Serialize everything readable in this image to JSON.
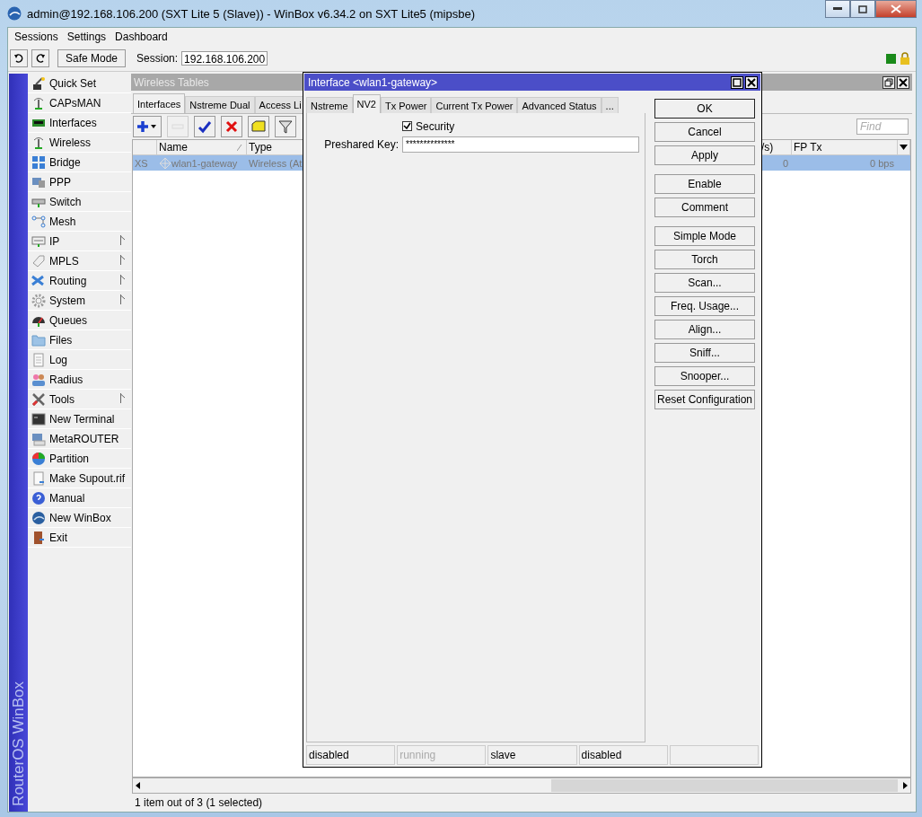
{
  "window": {
    "title": "admin@192.168.106.200 (SXT Lite 5 (Slave)) - WinBox v6.34.2 on SXT Lite5 (mipsbe)"
  },
  "menu": [
    "Sessions",
    "Settings",
    "Dashboard"
  ],
  "toolbar": {
    "safe_mode": "Safe Mode",
    "session_label": "Session:",
    "session": "192.168.106.200"
  },
  "sidebar": {
    "brand": "RouterOS WinBox",
    "items": [
      {
        "label": "Quick Set",
        "submenu": false
      },
      {
        "label": "CAPsMAN",
        "submenu": false
      },
      {
        "label": "Interfaces",
        "submenu": false
      },
      {
        "label": "Wireless",
        "submenu": false
      },
      {
        "label": "Bridge",
        "submenu": false
      },
      {
        "label": "PPP",
        "submenu": false
      },
      {
        "label": "Switch",
        "submenu": false
      },
      {
        "label": "Mesh",
        "submenu": false
      },
      {
        "label": "IP",
        "submenu": true
      },
      {
        "label": "MPLS",
        "submenu": true
      },
      {
        "label": "Routing",
        "submenu": true
      },
      {
        "label": "System",
        "submenu": true
      },
      {
        "label": "Queues",
        "submenu": false
      },
      {
        "label": "Files",
        "submenu": false
      },
      {
        "label": "Log",
        "submenu": false
      },
      {
        "label": "Radius",
        "submenu": false
      },
      {
        "label": "Tools",
        "submenu": true
      },
      {
        "label": "New Terminal",
        "submenu": false
      },
      {
        "label": "MetaROUTER",
        "submenu": false
      },
      {
        "label": "Partition",
        "submenu": false
      },
      {
        "label": "Make Supout.rif",
        "submenu": false
      },
      {
        "label": "Manual",
        "submenu": false
      },
      {
        "label": "New WinBox",
        "submenu": false
      },
      {
        "label": "Exit",
        "submenu": false
      }
    ]
  },
  "wireless_tables": {
    "title": "Wireless Tables",
    "tabs": [
      {
        "label": "Interfaces",
        "selected": true
      },
      {
        "label": "Nstreme Dual",
        "selected": false
      },
      {
        "label": "Access Li",
        "selected": false
      }
    ],
    "tools": [
      {
        "kind": "add",
        "disabled": false
      },
      {
        "kind": "remove",
        "disabled": true
      },
      {
        "kind": "enable",
        "disabled": false
      },
      {
        "kind": "disable",
        "disabled": false
      },
      {
        "kind": "comment",
        "disabled": false
      },
      {
        "kind": "filter",
        "disabled": false
      }
    ],
    "find": {
      "placeholder": "Find"
    },
    "table": {
      "columns": [
        "Name",
        "Type",
        "/s)",
        "FP Tx"
      ],
      "rows": [
        {
          "flags": "XS",
          "name": "wlan1-gateway",
          "type": "Wireless (At",
          "column_3": "0",
          "fp_tx": "0 bps",
          "selected": true
        }
      ]
    },
    "status": "1 item out of 3 (1 selected)"
  },
  "dialog": {
    "title": "Interface <wlan1-gateway>",
    "tabs": [
      {
        "label": "Nstreme",
        "selected": false
      },
      {
        "label": "NV2",
        "selected": true
      },
      {
        "label": "Tx Power",
        "selected": false
      },
      {
        "label": "Current Tx Power",
        "selected": false
      },
      {
        "label": "Advanced Status",
        "selected": false
      },
      {
        "label": "...",
        "selected": false
      }
    ],
    "security": {
      "label": "Security",
      "checked": true
    },
    "preshared_key": {
      "label": "Preshared Key:",
      "value": "**************"
    },
    "button_groups": [
      [
        {
          "label": "OK",
          "default": true
        },
        {
          "label": "Cancel",
          "default": false
        },
        {
          "label": "Apply",
          "default": false
        }
      ],
      [
        {
          "label": "Enable",
          "default": false
        },
        {
          "label": "Comment",
          "default": false
        }
      ],
      [
        {
          "label": "Simple Mode",
          "default": false
        },
        {
          "label": "Torch",
          "default": false
        },
        {
          "label": "Scan...",
          "default": false
        },
        {
          "label": "Freq. Usage...",
          "default": false
        },
        {
          "label": "Align...",
          "default": false
        },
        {
          "label": "Sniff...",
          "default": false
        },
        {
          "label": "Snooper...",
          "default": false
        },
        {
          "label": "Reset Configuration",
          "default": false
        }
      ]
    ],
    "status": [
      {
        "text": "disabled",
        "dimmed": false
      },
      {
        "text": "running",
        "dimmed": true
      },
      {
        "text": "slave",
        "dimmed": false
      },
      {
        "text": "disabled",
        "dimmed": false
      }
    ]
  }
}
